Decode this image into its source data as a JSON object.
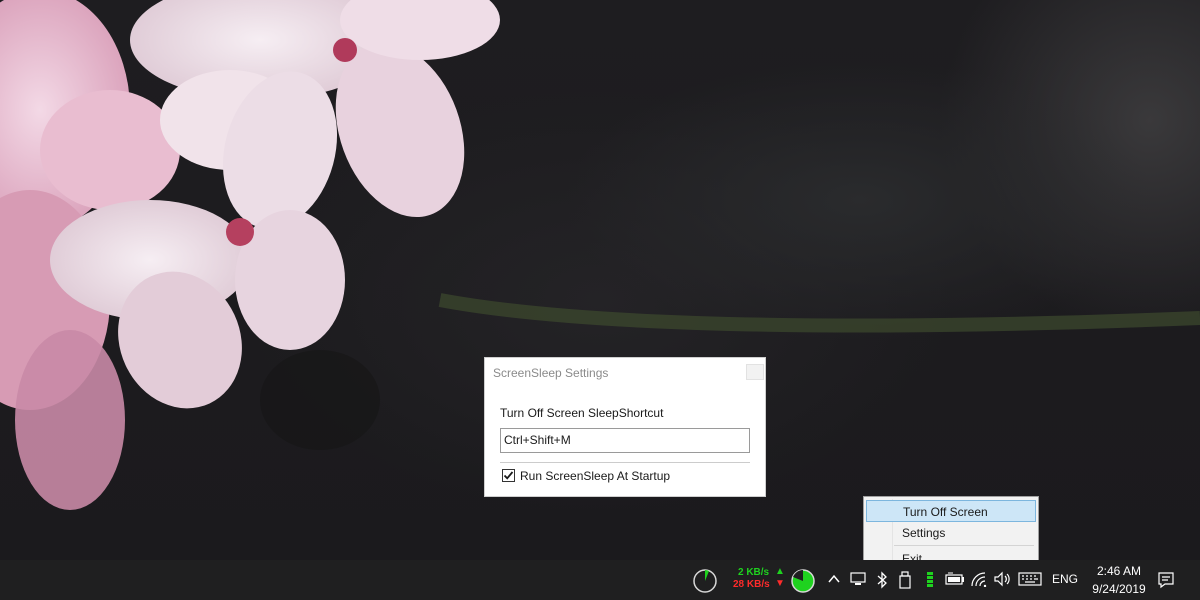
{
  "dialog": {
    "title": "ScreenSleep  Settings",
    "shortcut_label": "Turn Off Screen SleepShortcut",
    "shortcut_value": "Ctrl+Shift+M",
    "startup_label": "Run ScreenSleep At Startup",
    "startup_checked": true
  },
  "context_menu": {
    "items": [
      {
        "label": "Turn Off Screen",
        "highlighted": true
      },
      {
        "label": "Settings"
      },
      {
        "label": "Exit"
      }
    ]
  },
  "taskbar": {
    "network": {
      "upload": "2 KB/s",
      "download": "28 KB/s",
      "upload_color": "#1fd21f",
      "download_color": "#ff2b2b"
    },
    "tray_icons": [
      "cpu-gauge-icon",
      "memory-gauge-icon",
      "chevron-up-icon",
      "display-icon",
      "bluetooth-icon",
      "usb-drive-icon",
      "battery-meter-icon",
      "battery-icon",
      "wifi-icon",
      "volume-icon",
      "keyboard-icon"
    ],
    "language": "ENG",
    "time": "2:46 AM",
    "date": "9/24/2019",
    "notification_icon": "action-center-icon"
  }
}
